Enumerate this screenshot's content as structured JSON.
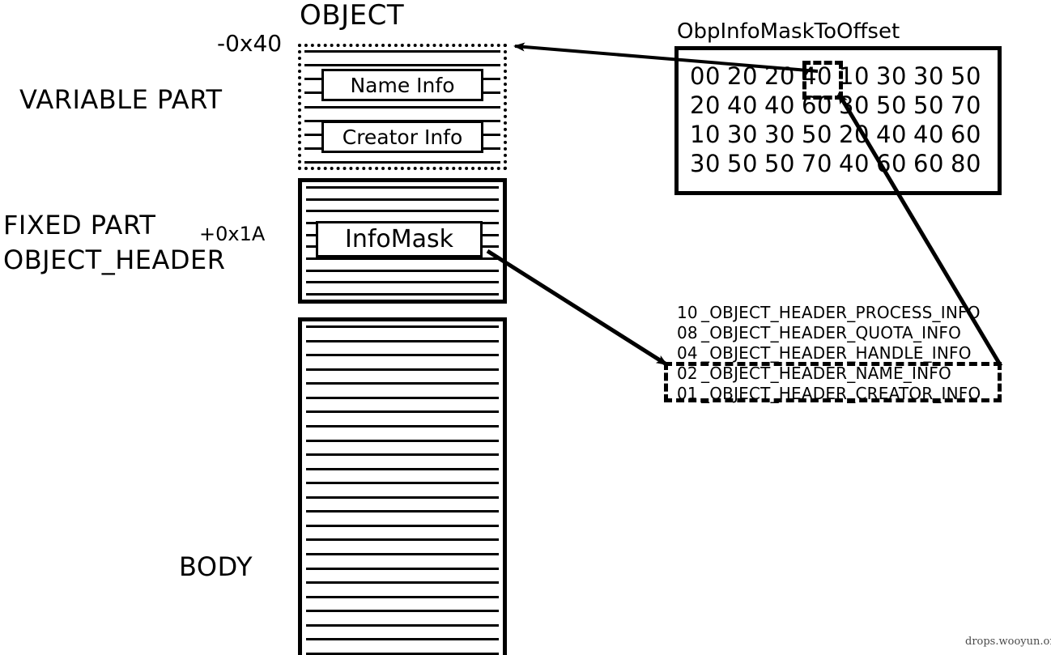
{
  "diagram": {
    "title": "OBJECT",
    "watermark": "drops.wooyun.org",
    "labels": {
      "variable_part": "VARIABLE PART",
      "fixed_part": "FIXED PART",
      "object_header": "OBJECT_HEADER",
      "body": "BODY",
      "offset_top": "-0x40",
      "offset_infomask": "+0x1A"
    },
    "variable_part": {
      "fields": [
        {
          "label": "Name Info"
        },
        {
          "label": "Creator Info"
        }
      ]
    },
    "fixed_part": {
      "fields": [
        {
          "label": "InfoMask"
        }
      ]
    },
    "lookup_table": {
      "title": "ObpInfoMaskToOffset",
      "rows": [
        [
          "00",
          "20",
          "20",
          "40",
          "10",
          "30",
          "30",
          "50"
        ],
        [
          "20",
          "40",
          "40",
          "60",
          "30",
          "50",
          "50",
          "70"
        ],
        [
          "10",
          "30",
          "30",
          "50",
          "20",
          "40",
          "40",
          "60"
        ],
        [
          "30",
          "50",
          "50",
          "70",
          "40",
          "60",
          "60",
          "80"
        ]
      ],
      "highlighted_value": "40"
    },
    "legend": {
      "entries": [
        {
          "code": "10",
          "name": "_OBJECT_HEADER_PROCESS_INFO"
        },
        {
          "code": "08",
          "name": "_OBJECT_HEADER_QUOTA_INFO"
        },
        {
          "code": "04",
          "name": "_OBJECT_HEADER_HANDLE_INFO"
        },
        {
          "code": "02",
          "name": "_OBJECT_HEADER_NAME_INFO"
        },
        {
          "code": "01",
          "name": "_OBJECT_HEADER_CREATOR_INFO"
        }
      ],
      "highlighted_codes": [
        "02",
        "01"
      ]
    },
    "colors": {
      "stroke": "#000000",
      "background": "#ffffff"
    }
  }
}
